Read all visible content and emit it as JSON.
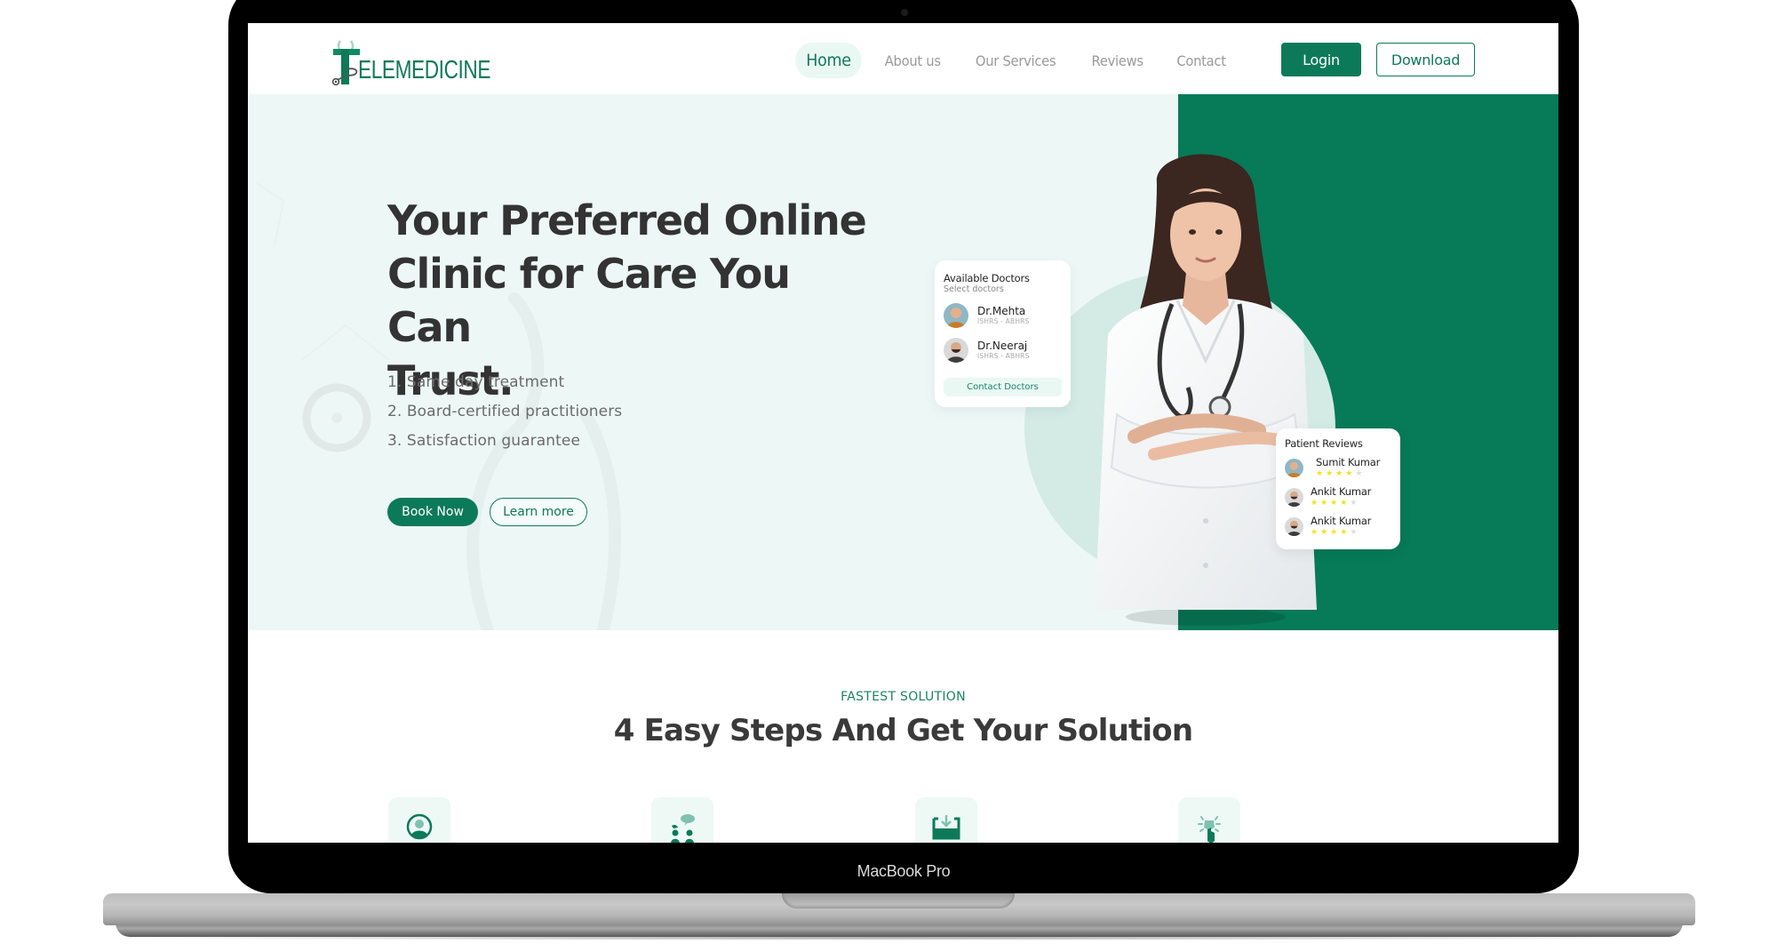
{
  "device": {
    "label": "MacBook Pro"
  },
  "brand": {
    "name": "ELEMEDICINE",
    "initial": "T",
    "full_name": "TELEMEDICINE",
    "accent_color": "#0c7a58",
    "light_accent_color": "#eaf8f4"
  },
  "nav": {
    "items": [
      {
        "label": "Home",
        "active": true
      },
      {
        "label": "About us",
        "active": false
      },
      {
        "label": "Our Services",
        "active": false
      },
      {
        "label": "Reviews",
        "active": false
      },
      {
        "label": "Contact",
        "active": false
      }
    ],
    "login_label": "Login",
    "download_label": "Download"
  },
  "hero": {
    "title_lines": [
      "Your Preferred Online",
      "Clinic for Care You Can",
      "Trust."
    ],
    "features": [
      "1.  Same day treatment",
      "2. Board-certified practitioners",
      "3. Satisfaction guarantee"
    ],
    "book_label": "Book Now",
    "learn_label": "Learn more"
  },
  "available_doctors": {
    "title": "Available Doctors",
    "subtitle": "Select doctors",
    "doctors": [
      {
        "name": "Dr.Mehta",
        "credentials": "ISHRS - ABHRS"
      },
      {
        "name": "Dr.Neeraj",
        "credentials": "ISHRS - ABHRS"
      }
    ],
    "contact_label": "Contact Doctors"
  },
  "patient_reviews": {
    "title": "Patient Reviews",
    "reviews": [
      {
        "name": "Sumit Kumar",
        "rating": 4,
        "max": 5
      },
      {
        "name": "Ankit Kumar",
        "rating": 4,
        "max": 5
      },
      {
        "name": "Ankit Kumar",
        "rating": 4,
        "max": 5
      }
    ]
  },
  "steps_section": {
    "kicker": "FASTEST SOLUTION",
    "title": "4 Easy Steps And Get Your Solution",
    "step_icons": [
      "user-profile-icon",
      "consultation-chat-icon",
      "download-inbox-icon",
      "tap-click-icon"
    ]
  }
}
